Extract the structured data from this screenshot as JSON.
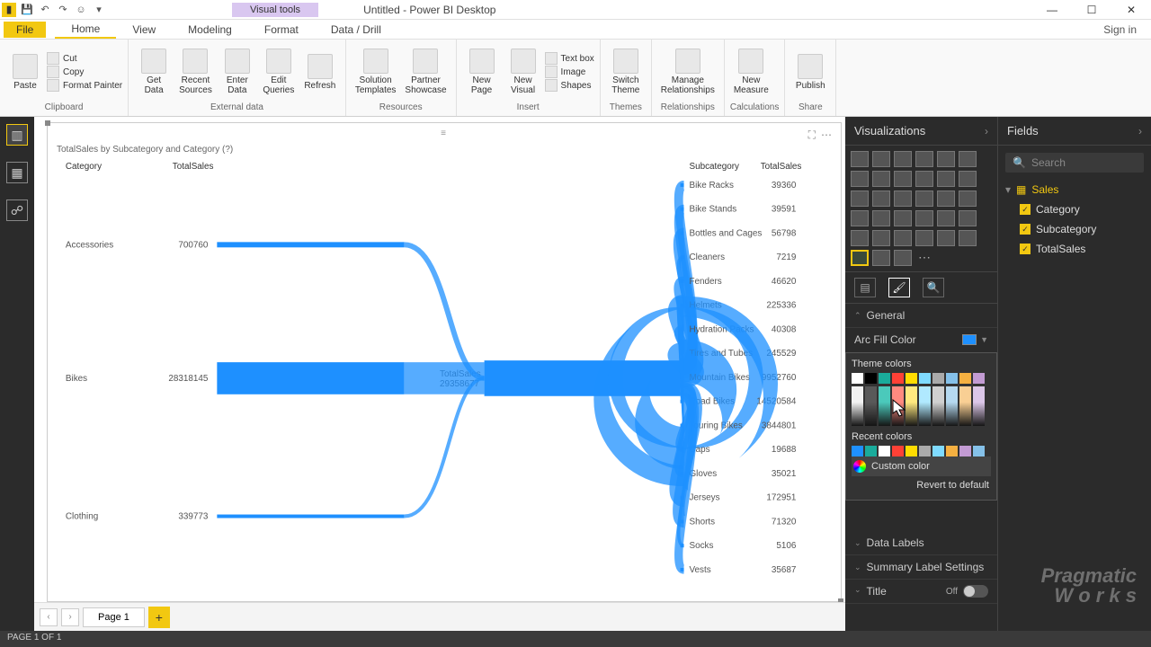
{
  "app": {
    "title": "Untitled - Power BI Desktop",
    "visual_tools": "Visual tools"
  },
  "menu": {
    "file": "File",
    "home": "Home",
    "view": "View",
    "modeling": "Modeling",
    "format": "Format",
    "datadrill": "Data / Drill",
    "signin": "Sign in"
  },
  "ribbon": {
    "clipboard": {
      "label": "Clipboard",
      "paste": "Paste",
      "cut": "Cut",
      "copy": "Copy",
      "fp": "Format Painter"
    },
    "external": {
      "label": "External data",
      "get": "Get\nData",
      "recent": "Recent\nSources",
      "enter": "Enter\nData",
      "edit": "Edit\nQueries",
      "refresh": "Refresh"
    },
    "resources": {
      "label": "Resources",
      "sol": "Solution\nTemplates",
      "psc": "Partner\nShowcase"
    },
    "insert": {
      "label": "Insert",
      "newpage": "New\nPage",
      "newvis": "New\nVisual",
      "textbox": "Text box",
      "image": "Image",
      "shapes": "Shapes"
    },
    "themes": {
      "label": "Themes",
      "switch": "Switch\nTheme"
    },
    "rel": {
      "label": "Relationships",
      "manage": "Manage\nRelationships"
    },
    "calc": {
      "label": "Calculations",
      "newm": "New\nMeasure"
    },
    "share": {
      "label": "Share",
      "publish": "Publish"
    }
  },
  "chart": {
    "title": "TotalSales by Subcategory and Category (?)",
    "cat_header": "Category",
    "ts_header": "TotalSales",
    "sub_header": "Subcategory",
    "mid_label": "TotalSales",
    "mid_value": "29358677",
    "categories": [
      {
        "name": "Accessories",
        "value": "700760"
      },
      {
        "name": "Bikes",
        "value": "28318145"
      },
      {
        "name": "Clothing",
        "value": "339773"
      }
    ],
    "subcategories": [
      {
        "name": "Bike Racks",
        "value": "39360",
        "cat": 0
      },
      {
        "name": "Bike Stands",
        "value": "39591",
        "cat": 0
      },
      {
        "name": "Bottles and Cages",
        "value": "56798",
        "cat": 0
      },
      {
        "name": "Cleaners",
        "value": "7219",
        "cat": 0
      },
      {
        "name": "Fenders",
        "value": "46620",
        "cat": 0
      },
      {
        "name": "Helmets",
        "value": "225336",
        "cat": 0
      },
      {
        "name": "Hydration Packs",
        "value": "40308",
        "cat": 0
      },
      {
        "name": "Tires and Tubes",
        "value": "245529",
        "cat": 0
      },
      {
        "name": "Mountain Bikes",
        "value": "9952760",
        "cat": 1
      },
      {
        "name": "Road Bikes",
        "value": "14520584",
        "cat": 1
      },
      {
        "name": "Touring Bikes",
        "value": "3844801",
        "cat": 1
      },
      {
        "name": "Caps",
        "value": "19688",
        "cat": 2
      },
      {
        "name": "Gloves",
        "value": "35021",
        "cat": 2
      },
      {
        "name": "Jerseys",
        "value": "172951",
        "cat": 2
      },
      {
        "name": "Shorts",
        "value": "71320",
        "cat": 2
      },
      {
        "name": "Socks",
        "value": "5106",
        "cat": 2
      },
      {
        "name": "Vests",
        "value": "35687",
        "cat": 2
      }
    ]
  },
  "chart_data": {
    "type": "sankey",
    "title": "TotalSales by Subcategory and Category",
    "total": 29358677,
    "nodes_left": [
      {
        "name": "Accessories",
        "value": 700760
      },
      {
        "name": "Bikes",
        "value": 28318145
      },
      {
        "name": "Clothing",
        "value": 339773
      }
    ],
    "nodes_right": [
      {
        "name": "Bike Racks",
        "value": 39360,
        "parent": "Accessories"
      },
      {
        "name": "Bike Stands",
        "value": 39591,
        "parent": "Accessories"
      },
      {
        "name": "Bottles and Cages",
        "value": 56798,
        "parent": "Accessories"
      },
      {
        "name": "Cleaners",
        "value": 7219,
        "parent": "Accessories"
      },
      {
        "name": "Fenders",
        "value": 46620,
        "parent": "Accessories"
      },
      {
        "name": "Helmets",
        "value": 225336,
        "parent": "Accessories"
      },
      {
        "name": "Hydration Packs",
        "value": 40308,
        "parent": "Accessories"
      },
      {
        "name": "Tires and Tubes",
        "value": 245529,
        "parent": "Accessories"
      },
      {
        "name": "Mountain Bikes",
        "value": 9952760,
        "parent": "Bikes"
      },
      {
        "name": "Road Bikes",
        "value": 14520584,
        "parent": "Bikes"
      },
      {
        "name": "Touring Bikes",
        "value": 3844801,
        "parent": "Bikes"
      },
      {
        "name": "Caps",
        "value": 19688,
        "parent": "Clothing"
      },
      {
        "name": "Gloves",
        "value": 35021,
        "parent": "Clothing"
      },
      {
        "name": "Jerseys",
        "value": 172951,
        "parent": "Clothing"
      },
      {
        "name": "Shorts",
        "value": 71320,
        "parent": "Clothing"
      },
      {
        "name": "Socks",
        "value": 5106,
        "parent": "Clothing"
      },
      {
        "name": "Vests",
        "value": 35687,
        "parent": "Clothing"
      }
    ]
  },
  "pages": {
    "page1": "Page 1",
    "status": "PAGE 1 OF 1"
  },
  "panes": {
    "viz": "Visualizations",
    "fields": "Fields"
  },
  "format": {
    "general": "General",
    "arc": "Arc Fill Color",
    "theme": "Theme colors",
    "recent": "Recent colors",
    "custom": "Custom color",
    "revert": "Revert to default",
    "datalabels": "Data Labels",
    "summary": "Summary Label Settings",
    "title": "Title",
    "off": "Off"
  },
  "fields": {
    "search": "Search",
    "table": "Sales",
    "items": [
      "Category",
      "Subcategory",
      "TotalSales"
    ]
  },
  "colors": {
    "theme_row": [
      "#ffffff",
      "#000000",
      "#1aab9b",
      "#ff4136",
      "#ffdc00",
      "#7fdbff",
      "#aaaaaa",
      "#85c1e9",
      "#f5b041",
      "#c39bd3"
    ],
    "theme_cols": [
      "#f2f2f2",
      "#595959",
      "#4bc9bb",
      "#ff8a80",
      "#ffe97f",
      "#b0e9ff",
      "#d0d0d0",
      "#b5d9f0",
      "#f9cf94",
      "#dcc7e8"
    ],
    "recent": [
      "#1e90ff",
      "#1aab9b",
      "#ffffff",
      "#ff4136",
      "#ffdc00",
      "#aaaaaa",
      "#7fdbff",
      "#f5b041",
      "#c39bd3",
      "#85c1e9"
    ]
  },
  "watermark": {
    "l1": "Pragmatic",
    "l2": "W o r k s"
  }
}
